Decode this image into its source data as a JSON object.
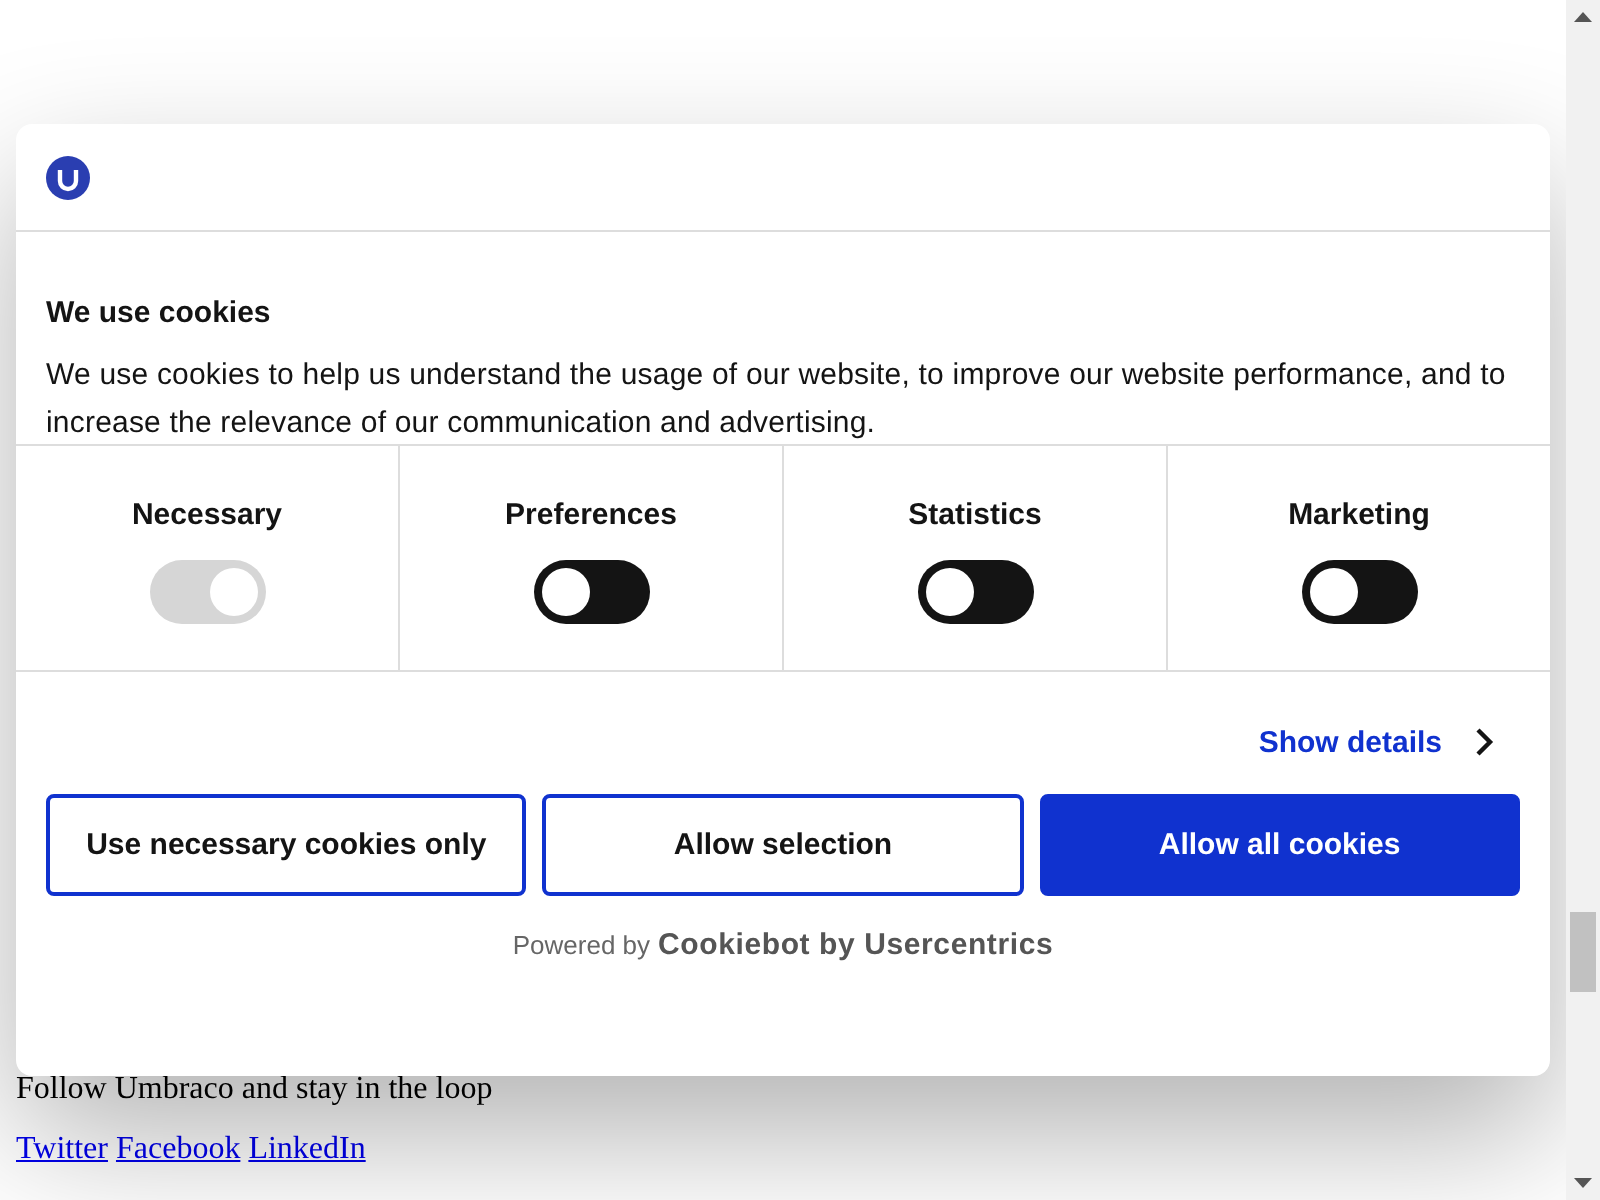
{
  "page": {
    "follow_text": "Follow Umbraco and stay in the loop",
    "links": [
      "Twitter",
      "Facebook",
      "LinkedIn"
    ]
  },
  "dialog": {
    "title": "We use cookies",
    "description": "We use cookies to help us understand the usage of our website, to improve our website performance, and to increase the relevance of our communication and advertising.",
    "categories": [
      {
        "label": "Necessary",
        "checked": true,
        "disabled": true
      },
      {
        "label": "Preferences",
        "checked": false,
        "disabled": false
      },
      {
        "label": "Statistics",
        "checked": false,
        "disabled": false
      },
      {
        "label": "Marketing",
        "checked": false,
        "disabled": false
      }
    ],
    "show_details": "Show details",
    "buttons": [
      {
        "label": "Use necessary cookies only",
        "kind": "outline"
      },
      {
        "label": "Allow selection",
        "kind": "outline"
      },
      {
        "label": "Allow all cookies",
        "kind": "primary"
      }
    ],
    "powered_by": "Powered by",
    "brand": "Cookiebot by Usercentrics"
  }
}
